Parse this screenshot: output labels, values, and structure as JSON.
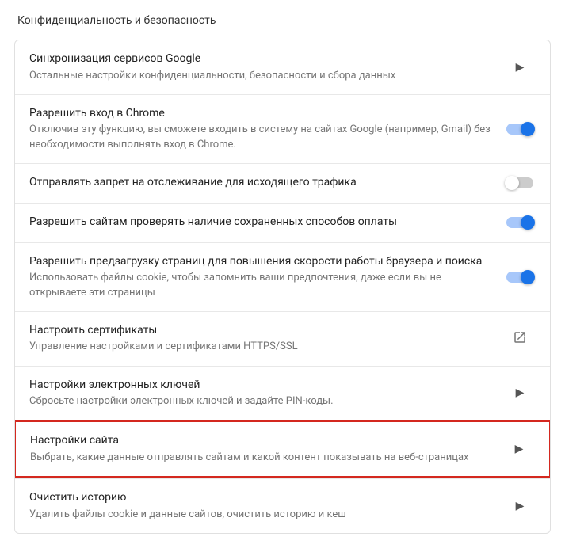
{
  "section_title": "Конфиденциальность и безопасность",
  "rows": [
    {
      "title": "Синхронизация сервисов Google",
      "desc": "Остальные настройки конфиденциальности, безопасности и сбора данных"
    },
    {
      "title": "Разрешить вход в Chrome",
      "desc": "Отключив эту функцию, вы сможете входить в систему на сайтах Google (например, Gmail) без необходимости выполнять вход в Chrome."
    },
    {
      "title": "Отправлять запрет на отслеживание для исходящего трафика"
    },
    {
      "title": "Разрешить сайтам проверять наличие сохраненных способов оплаты"
    },
    {
      "title": "Разрешить предзагрузку страниц для повышения скорости работы браузера и поиска",
      "desc": "Использовать файлы cookie, чтобы запомнить ваши предпочтения, даже если вы не открываете эти страницы"
    },
    {
      "title": "Настроить сертификаты",
      "desc": "Управление настройками и сертификатами HTTPS/SSL"
    },
    {
      "title": "Настройки электронных ключей",
      "desc": "Сбросьте настройки электронных ключей и задайте PIN-коды."
    },
    {
      "title": "Настройки сайта",
      "desc": "Выбрать, какие данные отправлять сайтам и какой контент показывать на веб-страницах"
    },
    {
      "title": "Очистить историю",
      "desc": "Удалить файлы cookie и данные сайтов, очистить историю и кеш"
    }
  ]
}
